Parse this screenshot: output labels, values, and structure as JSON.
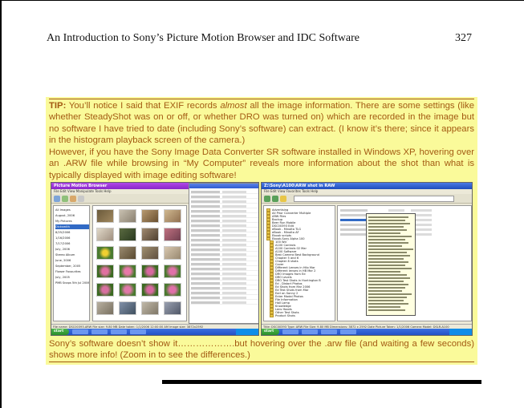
{
  "header": {
    "title": "An Introduction to Sony’s Picture Motion Browser and IDC Software",
    "page_number": "327"
  },
  "note": {
    "tip_label": "TIP:",
    "paragraph1_before": " You’ll notice I said that EXIF records ",
    "paragraph1_emphasis": "almost",
    "paragraph1_after": " all the image information.  There are some settings (like whether SteadyShot was on or off, or whether DRO was turned on) which are recorded in the image but no software I have tried to date (including Sony’s software) can extract. (I know it’s there; since it appears in the histogram playback screen of the camera.)",
    "paragraph2": "However, if you have the Sony Image Data Converter SR software installed in Windows XP, hovering over an .ARW file while browsing in “My Computer” reveals more information about the shot than what is typically displayed with image editing software!",
    "paragraph3": "Sony’s software doesn’t show it……………….but hovering over the .arw file (and waiting a few seconds) shows more info!  (Zoom in to see the differences.)"
  },
  "screenshots": {
    "left": {
      "window_title": "Picture Motion Browser",
      "menu": "File   Edit   View   Manipulate   Tools   Help",
      "tree_items": [
        "All Images",
        "August, 2006",
        "My Pictures",
        "Dicksmith",
        "8/25/2006",
        "1/16/2006",
        "7/17/2006",
        "July, 2006",
        "Stereo Album",
        "June, 2006",
        "September, 2005",
        "Flower Favourites",
        "July, 2005",
        "PMB Snaps 5th Jul 2006"
      ],
      "selected_tree_index": 3,
      "status": "File name: DSC00393.ARW  File size: 9.80 MB  Date taken: 1/1/2006 12:00:00 AM  Image size: 3872x2592",
      "start_label": "start"
    },
    "right": {
      "window_title": "Z:\\Sony\\A100\\ARW shot in RAW",
      "menu": "File   Edit   View   Favorites   Tools   Help",
      "folders": [
        "Advertising",
        "All Prior Converter Multiple",
        "ARW Files",
        "Backup",
        "Beer Run Mobile",
        "DSC00393 Edit",
        "eBook - Minolta TLG",
        "eBook - Minolta AF",
        "Ebook scripts",
        "Ebook-Sony Alpha 100",
        "100 Wd",
        "A100 Controls",
        "A100 Controls 02 Mar",
        "A100 Software",
        "Best Camera Best Background",
        "Chapter 5 and 6",
        "Chapter 8 shots",
        "Cover",
        "Different Lenses in Hilo Mar",
        "Different lenses in HB Mar 2",
        "DRO Images from Ed",
        "DRO Levels",
        "DRO Test Shots in Huntington B",
        "Ed - Distort Photos",
        "Ed Shots from Mar 2006",
        "Ed Test Shots from Mar",
        "Earl on Sonny 2",
        "Enter Modal Photos",
        "File Information",
        "Hall Lamp",
        "Knowledge",
        "Lens Hoods",
        "Other Test Shots",
        "Product Shots"
      ],
      "status": "Title: DSC00393 Type: ARW File Size: 9.80 MB Dimensions: 3872 x 2592 Date Picture Taken: 1/1/2006 Camera Model: DSLR-A100",
      "start_label": "start"
    }
  }
}
